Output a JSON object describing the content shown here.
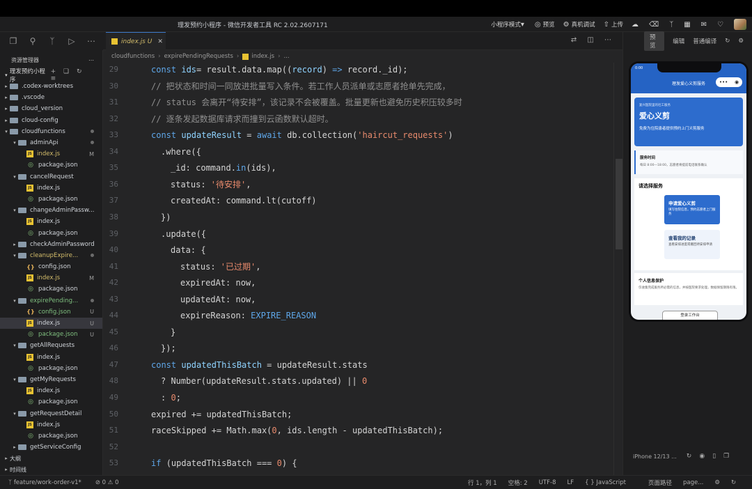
{
  "window": {
    "title": "理发预约小程序 - 微信开发者工具 RC 2.02.2607171",
    "toolbar": {
      "mode": "小程序模式",
      "preview": "预览",
      "device_debug": "真机调试",
      "upload": "上传"
    }
  },
  "sidebar": {
    "title": "资源管理器",
    "root": "理发预约小程序",
    "items": [
      {
        "label": ".codex-worktrees",
        "kind": "folder",
        "depth": 1,
        "expanded": false,
        "badge": ""
      },
      {
        "label": ".vscode",
        "kind": "folder",
        "depth": 1,
        "expanded": false,
        "badge": ""
      },
      {
        "label": "cloud_version",
        "kind": "folder",
        "depth": 1,
        "expanded": false,
        "badge": ""
      },
      {
        "label": "cloud-config",
        "kind": "folder",
        "depth": 1,
        "expanded": false,
        "badge": ""
      },
      {
        "label": "cloudfunctions",
        "kind": "folder",
        "depth": 1,
        "expanded": true,
        "badge": "dot"
      },
      {
        "label": "adminApi",
        "kind": "folder",
        "depth": 2,
        "expanded": true,
        "badge": "dot"
      },
      {
        "label": "index.js",
        "kind": "js",
        "depth": 3,
        "badge": "M",
        "state": "mod"
      },
      {
        "label": "package.json",
        "kind": "pkg",
        "depth": 3,
        "badge": ""
      },
      {
        "label": "cancelRequest",
        "kind": "folder",
        "depth": 2,
        "expanded": true,
        "badge": ""
      },
      {
        "label": "index.js",
        "kind": "js",
        "depth": 3,
        "badge": ""
      },
      {
        "label": "package.json",
        "kind": "pkg",
        "depth": 3,
        "badge": ""
      },
      {
        "label": "changeAdminPassw...",
        "kind": "folder",
        "depth": 2,
        "expanded": true,
        "badge": ""
      },
      {
        "label": "index.js",
        "kind": "js",
        "depth": 3,
        "badge": ""
      },
      {
        "label": "package.json",
        "kind": "pkg",
        "depth": 3,
        "badge": ""
      },
      {
        "label": "checkAdminPassword",
        "kind": "folder",
        "depth": 2,
        "expanded": false,
        "badge": ""
      },
      {
        "label": "cleanupExpire...",
        "kind": "folder",
        "depth": 2,
        "expanded": true,
        "badge": "dot",
        "state": "mod"
      },
      {
        "label": "config.json",
        "kind": "json",
        "depth": 3,
        "badge": ""
      },
      {
        "label": "index.js",
        "kind": "js",
        "depth": 3,
        "badge": "M",
        "state": "mod"
      },
      {
        "label": "package.json",
        "kind": "pkg",
        "depth": 3,
        "badge": ""
      },
      {
        "label": "expirePending...",
        "kind": "folder",
        "depth": 2,
        "expanded": true,
        "badge": "dot",
        "state": "new"
      },
      {
        "label": "config.json",
        "kind": "json",
        "depth": 3,
        "badge": "U",
        "state": "new"
      },
      {
        "label": "index.js",
        "kind": "js",
        "depth": 3,
        "badge": "U",
        "state": "sel"
      },
      {
        "label": "package.json",
        "kind": "pkg",
        "depth": 3,
        "badge": "U",
        "state": "new"
      },
      {
        "label": "getAllRequests",
        "kind": "folder",
        "depth": 2,
        "expanded": true,
        "badge": ""
      },
      {
        "label": "index.js",
        "kind": "js",
        "depth": 3,
        "badge": ""
      },
      {
        "label": "package.json",
        "kind": "pkg",
        "depth": 3,
        "badge": ""
      },
      {
        "label": "getMyRequests",
        "kind": "folder",
        "depth": 2,
        "expanded": true,
        "badge": ""
      },
      {
        "label": "index.js",
        "kind": "js",
        "depth": 3,
        "badge": ""
      },
      {
        "label": "package.json",
        "kind": "pkg",
        "depth": 3,
        "badge": ""
      },
      {
        "label": "getRequestDetail",
        "kind": "folder",
        "depth": 2,
        "expanded": true,
        "badge": ""
      },
      {
        "label": "index.js",
        "kind": "js",
        "depth": 3,
        "badge": ""
      },
      {
        "label": "package.json",
        "kind": "pkg",
        "depth": 3,
        "badge": ""
      },
      {
        "label": "getServiceConfig",
        "kind": "folder",
        "depth": 2,
        "expanded": false,
        "badge": ""
      }
    ],
    "footer": [
      "大纲",
      "时间线"
    ]
  },
  "editor": {
    "tab": {
      "label": "index.js",
      "status": "U"
    },
    "breadcrumb": [
      "cloudfunctions",
      "expirePendingRequests",
      "index.js",
      "..."
    ],
    "lines": [
      {
        "n": "29",
        "indent": 0,
        "tokens": [
          [
            "kw",
            "const "
          ],
          [
            "var",
            "ids"
          ],
          [
            "",
            "= result.data.map(("
          ],
          [
            "var",
            "record"
          ],
          [
            "",
            ") "
          ],
          [
            "kw",
            "=>"
          ],
          [
            "",
            " record._id);"
          ]
        ]
      },
      {
        "n": "30",
        "indent": 0,
        "tokens": [
          [
            "cmt",
            "// 把状态和时间一同放进批量写入条件。若工作人员派单或志愿者抢单先完成，"
          ]
        ]
      },
      {
        "n": "31",
        "indent": 0,
        "tokens": [
          [
            "cmt",
            "// status 会离开“待安排”，该记录不会被覆盖。批量更新也避免历史积压较多时"
          ]
        ]
      },
      {
        "n": "32",
        "indent": 0,
        "tokens": [
          [
            "cmt",
            "// 逐条发起数据库请求而撞到云函数默认超时。"
          ]
        ]
      },
      {
        "n": "33",
        "indent": 0,
        "tokens": [
          [
            "kw",
            "const "
          ],
          [
            "var",
            "updateResult"
          ],
          [
            "",
            " = "
          ],
          [
            "kw",
            "await "
          ],
          [
            "",
            "db.collection("
          ],
          [
            "str",
            "'haircut_requests'"
          ],
          [
            "",
            ")"
          ]
        ]
      },
      {
        "n": "34",
        "indent": 1,
        "tokens": [
          [
            "",
            ".where({"
          ]
        ]
      },
      {
        "n": "35",
        "indent": 2,
        "tokens": [
          [
            "",
            "_id: command."
          ],
          [
            "kw",
            "in"
          ],
          [
            "",
            "(ids),"
          ]
        ]
      },
      {
        "n": "36",
        "indent": 2,
        "tokens": [
          [
            "",
            "status: "
          ],
          [
            "str",
            "'待安排'"
          ],
          [
            "",
            ","
          ]
        ]
      },
      {
        "n": "37",
        "indent": 2,
        "tokens": [
          [
            "",
            "createdAt: command.lt(cutoff)"
          ]
        ]
      },
      {
        "n": "38",
        "indent": 1,
        "tokens": [
          [
            "",
            "})"
          ]
        ]
      },
      {
        "n": "39",
        "indent": 1,
        "tokens": [
          [
            "",
            ".update({"
          ]
        ]
      },
      {
        "n": "40",
        "indent": 2,
        "tokens": [
          [
            "",
            "data: {"
          ]
        ]
      },
      {
        "n": "41",
        "indent": 3,
        "tokens": [
          [
            "",
            "status: "
          ],
          [
            "str",
            "'已过期'"
          ],
          [
            "",
            ","
          ]
        ]
      },
      {
        "n": "42",
        "indent": 3,
        "tokens": [
          [
            "",
            "expiredAt: now,"
          ]
        ]
      },
      {
        "n": "43",
        "indent": 3,
        "tokens": [
          [
            "",
            "updatedAt: now,"
          ]
        ]
      },
      {
        "n": "44",
        "indent": 3,
        "tokens": [
          [
            "",
            "expireReason: "
          ],
          [
            "cst",
            "EXPIRE_REASON"
          ]
        ]
      },
      {
        "n": "45",
        "indent": 2,
        "tokens": [
          [
            "",
            "}"
          ]
        ]
      },
      {
        "n": "46",
        "indent": 1,
        "tokens": [
          [
            "",
            "});"
          ]
        ]
      },
      {
        "n": "47",
        "indent": 0,
        "tokens": [
          [
            "kw",
            "const "
          ],
          [
            "var",
            "updatedThisBatch"
          ],
          [
            "",
            " = updateResult.stats"
          ]
        ]
      },
      {
        "n": "48",
        "indent": 1,
        "tokens": [
          [
            "",
            "? Number(updateResult.stats.updated) || "
          ],
          [
            "str",
            "0"
          ]
        ]
      },
      {
        "n": "49",
        "indent": 1,
        "tokens": [
          [
            "",
            ": "
          ],
          [
            "str",
            "0"
          ],
          [
            "",
            ";"
          ]
        ]
      },
      {
        "n": "50",
        "indent": 0,
        "tokens": [
          [
            "",
            "expired += updatedThisBatch;"
          ]
        ]
      },
      {
        "n": "51",
        "indent": 0,
        "tokens": [
          [
            "",
            "raceSkipped += Math.max("
          ],
          [
            "str",
            "0"
          ],
          [
            "",
            ", ids.length - updatedThisBatch);"
          ]
        ]
      },
      {
        "n": "52",
        "indent": 0,
        "tokens": []
      },
      {
        "n": "53",
        "indent": 0,
        "tokens": [
          [
            "kw",
            "if "
          ],
          [
            "",
            "(updatedThisBatch === "
          ],
          [
            "str",
            "0"
          ],
          [
            "",
            ") {"
          ]
        ]
      }
    ]
  },
  "simulator": {
    "toolbar": {
      "preview": "预览",
      "edit": "编辑",
      "compile": "普通编译"
    },
    "status_time": "0:00",
    "nav_title": "理发爱心义剪服务",
    "hero": {
      "kicker": "复兴医院里的社工服务",
      "title": "爱心义剪",
      "subtitle": "免费为住院患者提供预约上门义剪服务"
    },
    "time_card": {
      "title": "服务时间",
      "desc": "每日 8:00—18:00，志愿者将提前电话联系确认"
    },
    "service": {
      "heading": "请选择服务",
      "primary": {
        "title": "申请爱心义剪",
        "desc": "填写住院信息，预约志愿者上门服务"
      },
      "secondary": {
        "title": "查看我的记录",
        "desc": "查看安排进度或撤回待安排申请"
      }
    },
    "privacy": {
      "title": "个人信息保护",
      "desc": "仅收集完成服务所必需的信息，并按医院要求处理，数据保留期限有限。"
    },
    "login_button": "登录工作台",
    "device": "iPhone 12/13 ..."
  },
  "statusbar": {
    "branch": "feature/work-order-v1*",
    "problems": "⊘ 0 ⚠ 0",
    "position": "行 1，列 1",
    "spaces": "空格: 2",
    "encoding": "UTF-8",
    "eol": "LF",
    "language": "JavaScript",
    "page_path": "页面路径",
    "page": "page..."
  }
}
